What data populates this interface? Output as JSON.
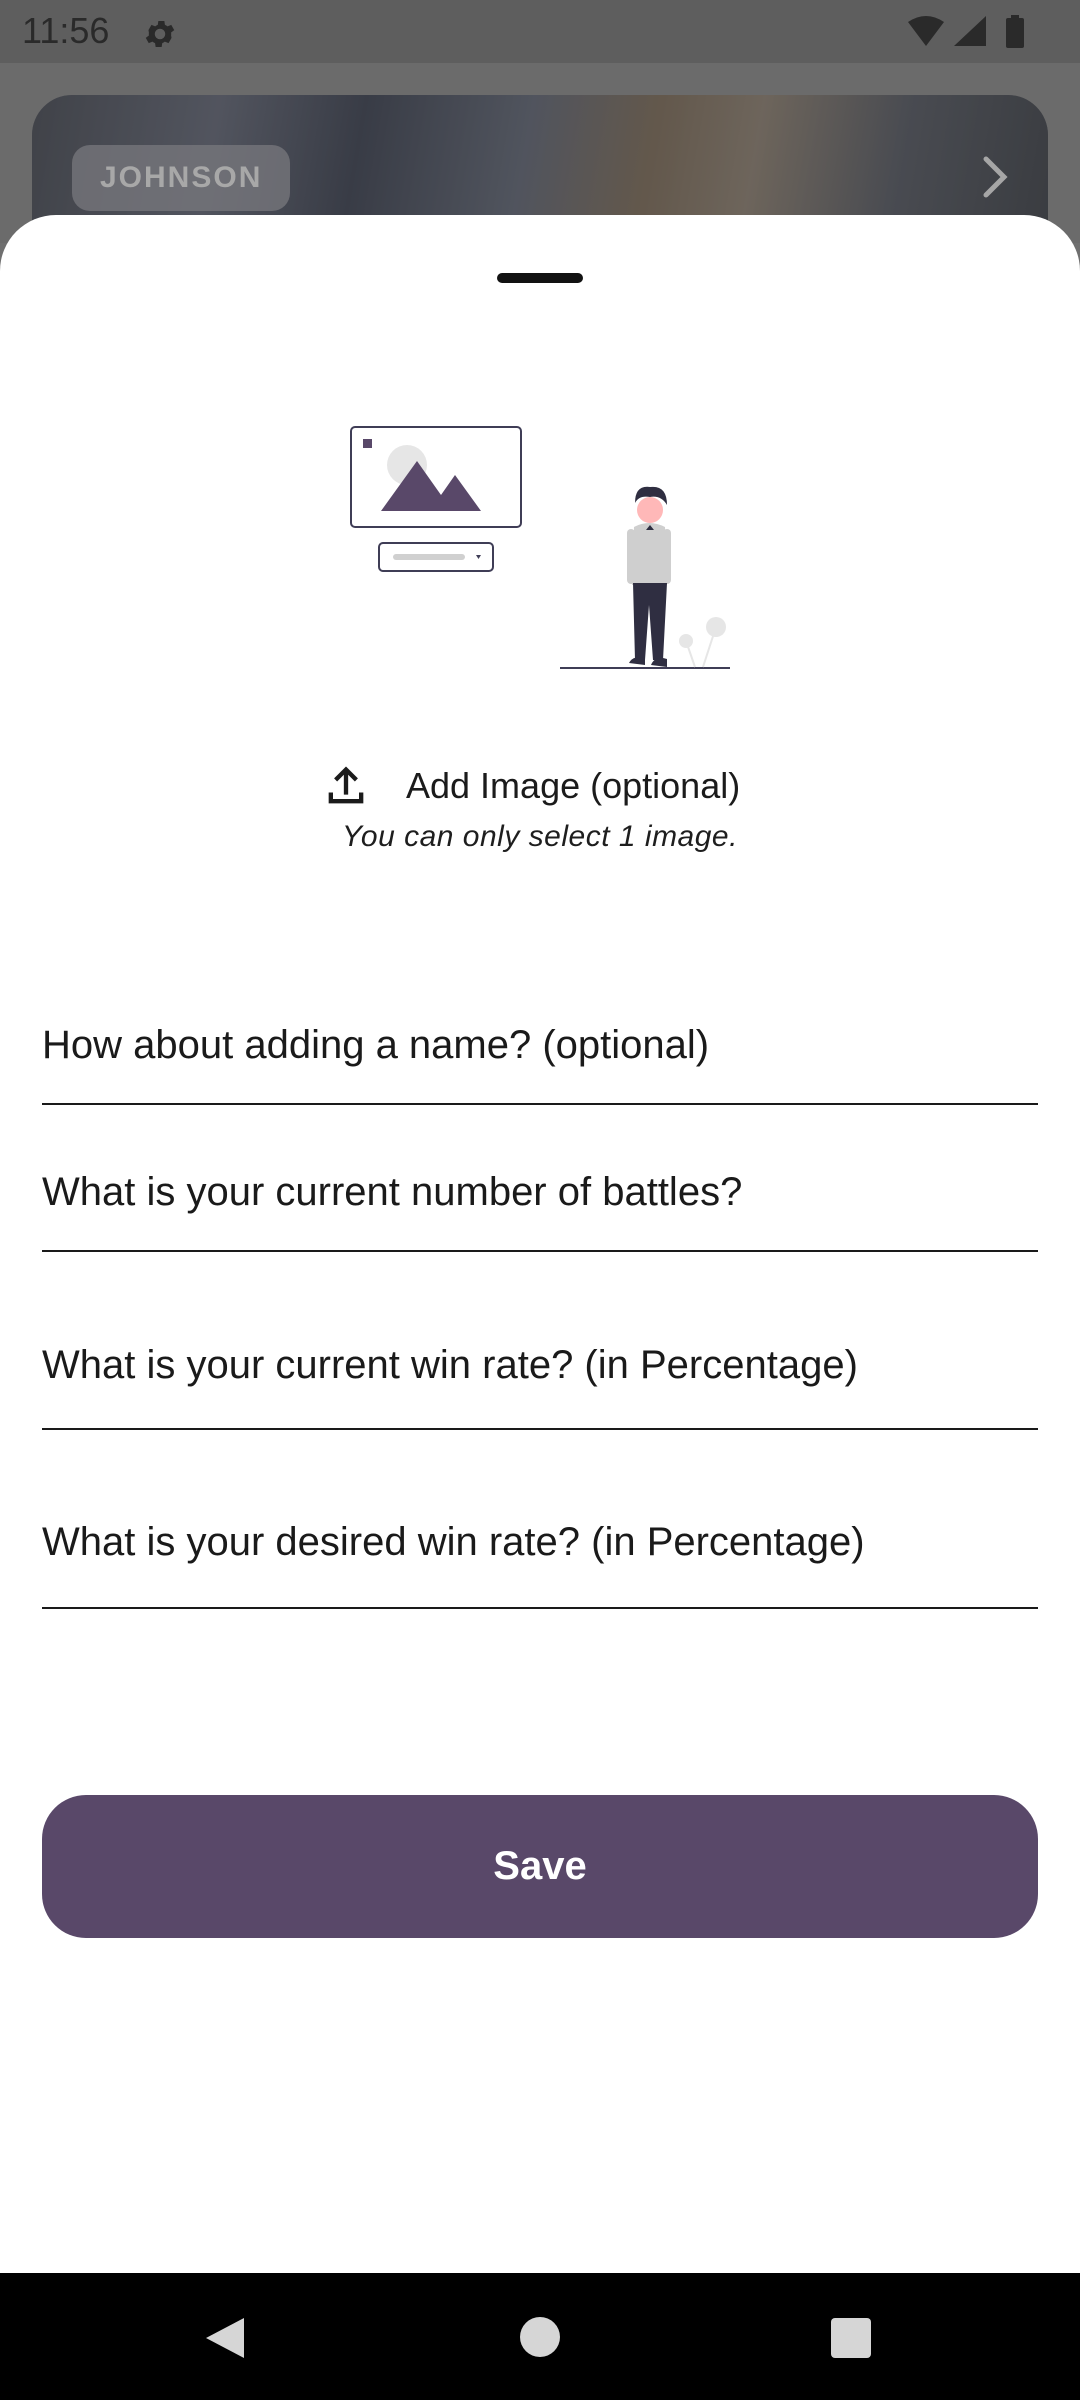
{
  "status_bar": {
    "time": "11:56",
    "icons": [
      "gear-icon",
      "wifi-icon",
      "signal-icon",
      "battery-icon"
    ]
  },
  "background": {
    "banner_label": "JOHNSON"
  },
  "sheet": {
    "add_image_label": "Add Image (optional)",
    "add_image_hint": "You can only select 1 image.",
    "fields": [
      {
        "placeholder": "How about adding a name? (optional)",
        "value": ""
      },
      {
        "placeholder": "What is your current number of battles?",
        "value": ""
      },
      {
        "placeholder": "What is your current win rate? (in Percentage)",
        "value": ""
      },
      {
        "placeholder": "What is your desired win rate? (in Percentage)",
        "value": ""
      }
    ],
    "save_label": "Save"
  },
  "colors": {
    "accent": "#594869",
    "illustration": "#594869"
  }
}
